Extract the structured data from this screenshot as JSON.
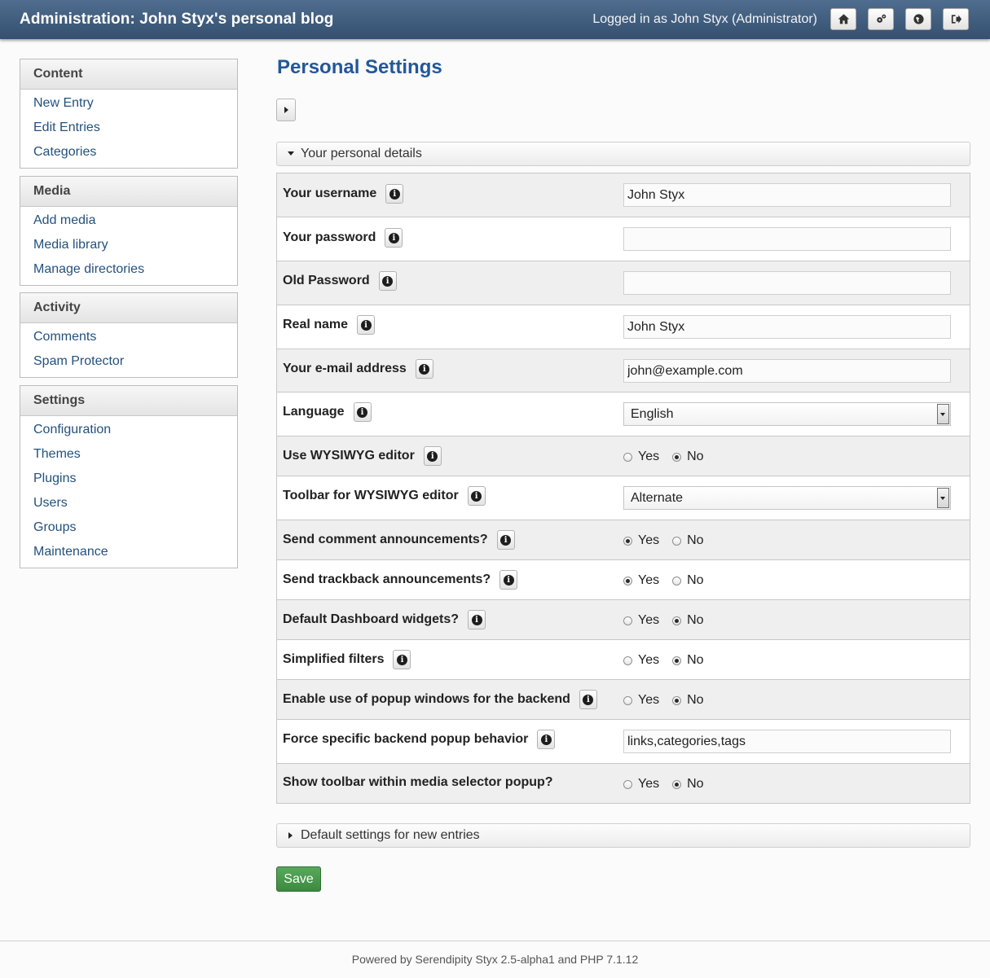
{
  "header": {
    "title": "Administration: John Styx's personal blog",
    "login_status": "Logged in as John Styx (Administrator)",
    "buttons": [
      "home-icon",
      "gears-icon",
      "globe-icon",
      "logout-icon"
    ]
  },
  "sidebar": {
    "content": {
      "title": "Content",
      "items": [
        "New Entry",
        "Edit Entries",
        "Categories"
      ]
    },
    "media": {
      "title": "Media",
      "items": [
        "Add media",
        "Media library",
        "Manage directories"
      ]
    },
    "activity": {
      "title": "Activity",
      "items": [
        "Comments",
        "Spam Protector"
      ]
    },
    "settings": {
      "title": "Settings",
      "items": [
        "Configuration",
        "Themes",
        "Plugins",
        "Users",
        "Groups",
        "Maintenance"
      ]
    }
  },
  "main": {
    "title": "Personal Settings",
    "section_personal": "Your personal details",
    "section_defaults": "Default settings for new entries",
    "fields": {
      "username": {
        "label": "Your username",
        "value": "John Styx"
      },
      "password": {
        "label": "Your password",
        "value": ""
      },
      "old_password": {
        "label": "Old Password",
        "value": ""
      },
      "real_name": {
        "label": "Real name",
        "value": "John Styx"
      },
      "email": {
        "label": "Your e-mail address",
        "value": "john@example.com"
      },
      "language": {
        "label": "Language",
        "value": "English"
      },
      "wysiwyg": {
        "label": "Use WYSIWYG editor",
        "value": "No"
      },
      "toolbar": {
        "label": "Toolbar for WYSIWYG editor",
        "value": "Alternate"
      },
      "comment_announce": {
        "label": "Send comment announcements?",
        "value": "Yes"
      },
      "trackback_announce": {
        "label": "Send trackback announcements?",
        "value": "Yes"
      },
      "dashboard_widgets": {
        "label": "Default Dashboard widgets?",
        "value": "No"
      },
      "simplified_filters": {
        "label": "Simplified filters",
        "value": "No"
      },
      "popup_windows": {
        "label": "Enable use of popup windows for the backend",
        "value": "No"
      },
      "popup_behavior": {
        "label": "Force specific backend popup behavior",
        "value": "links,categories,tags"
      },
      "media_toolbar": {
        "label": "Show toolbar within media selector popup?",
        "value": "No"
      }
    },
    "yes_label": "Yes",
    "no_label": "No",
    "save_label": "Save"
  },
  "footer": {
    "text": "Powered by Serendipity Styx 2.5-alpha1 and PHP 7.1.12"
  },
  "colors": {
    "header_bg": "#3f5d7f",
    "title": "#23579a",
    "link": "#23517e",
    "save": "#4a9a4e"
  }
}
